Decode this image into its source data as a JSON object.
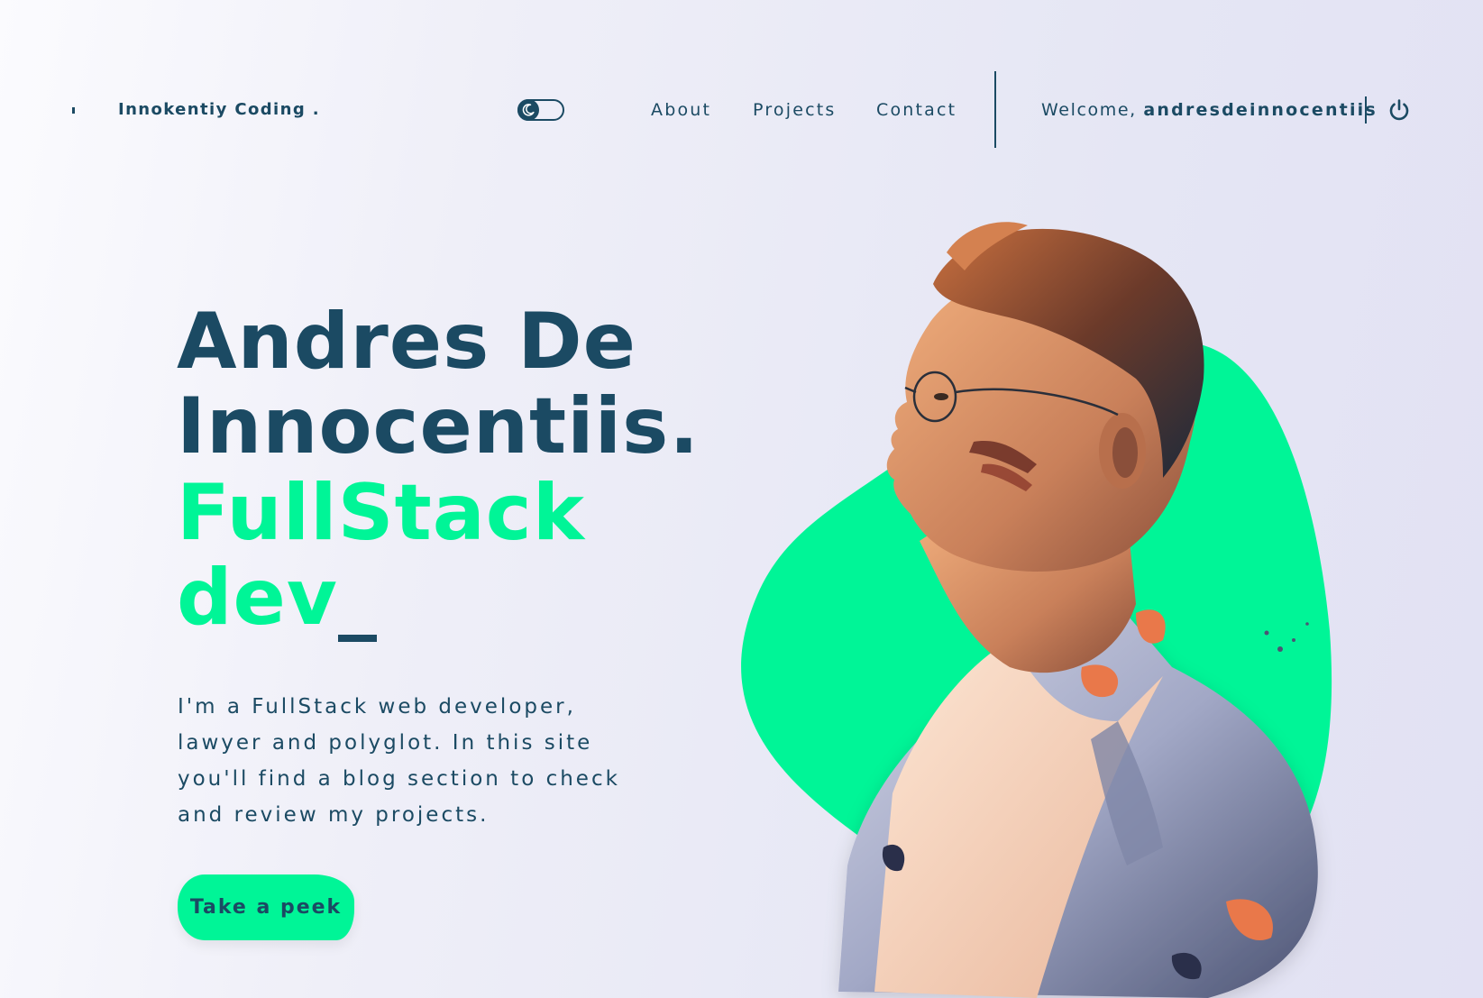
{
  "header": {
    "brand": "Innokentiy Coding .",
    "nav": {
      "about": "About",
      "projects": "Projects",
      "contact": "Contact"
    },
    "welcome_prefix": "Welcome,",
    "username": "andresdeinnocentiis",
    "theme_toggle_icon": "moon-icon",
    "logout_icon": "power-icon"
  },
  "hero": {
    "name_line1": "Andres De",
    "name_line2": "Innocentiis.",
    "role_line1": "FullStack",
    "role_line2": "dev",
    "cursor": "_",
    "description": "I'm a FullStack web developer, lawyer and polyglot. In this site you'll find a blog section to check and review my projects.",
    "cta_label": "Take a peek",
    "portrait_icon": "portrait-image"
  },
  "colors": {
    "primary": "#1b4a63",
    "accent": "#00f597",
    "background": "#eceaf6"
  }
}
